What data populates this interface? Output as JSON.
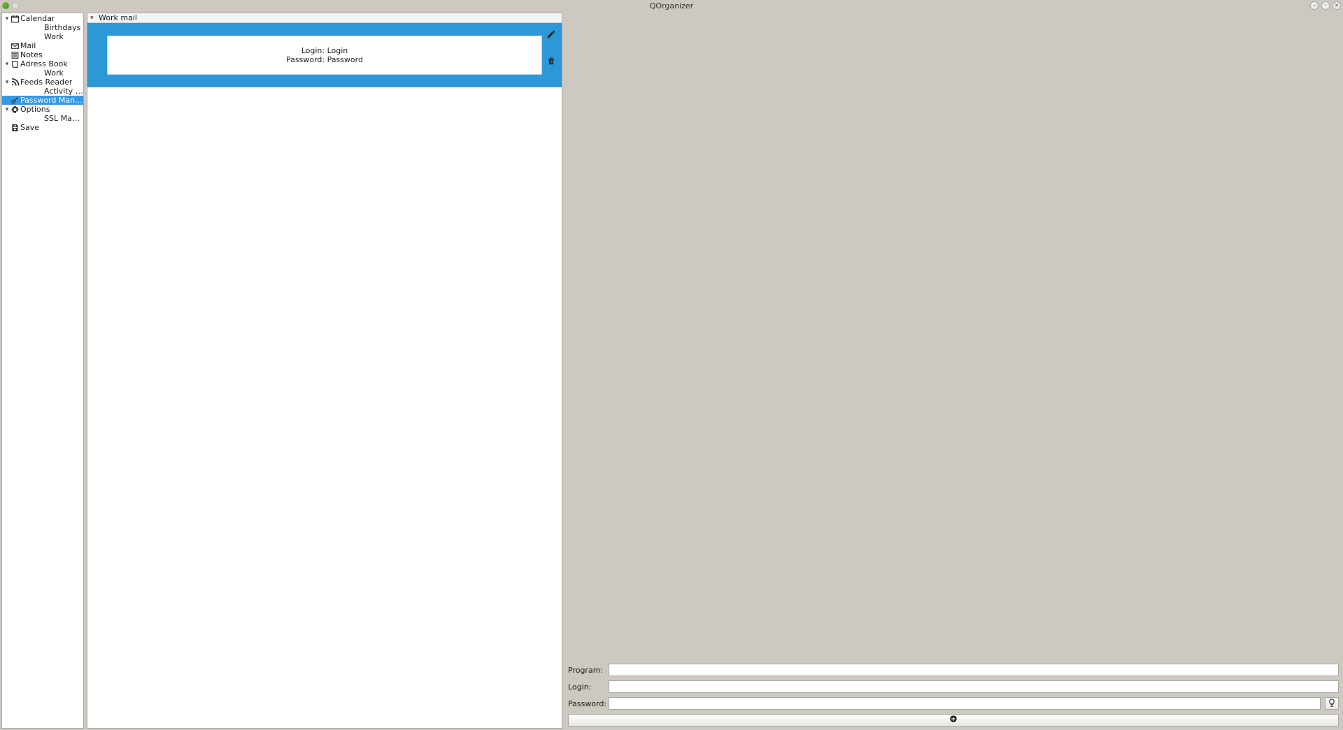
{
  "window": {
    "title": "QOrganizer"
  },
  "sidebar": {
    "items": [
      {
        "id": "calendar",
        "label": "Calendar",
        "icon": "calendar-icon",
        "expandable": true,
        "level": 0
      },
      {
        "id": "birthdays",
        "label": "Birthdays",
        "icon": "",
        "expandable": false,
        "level": 1
      },
      {
        "id": "work-cal",
        "label": "Work",
        "icon": "",
        "expandable": false,
        "level": 1
      },
      {
        "id": "mail",
        "label": "Mail",
        "icon": "mail-icon",
        "expandable": false,
        "level": 0
      },
      {
        "id": "notes",
        "label": "Notes",
        "icon": "notes-icon",
        "expandable": false,
        "level": 0
      },
      {
        "id": "addressbook",
        "label": "Adress Book",
        "icon": "book-icon",
        "expandable": true,
        "level": 0
      },
      {
        "id": "work-ab",
        "label": "Work",
        "icon": "",
        "expandable": false,
        "level": 1
      },
      {
        "id": "feeds",
        "label": "Feeds Reader",
        "icon": "rss-icon",
        "expandable": true,
        "level": 0
      },
      {
        "id": "activity",
        "label": "Activity for QO...",
        "icon": "",
        "expandable": false,
        "level": 1
      },
      {
        "id": "passwordman",
        "label": "Password Man...",
        "icon": "key-icon",
        "expandable": false,
        "level": 0,
        "selected": true
      },
      {
        "id": "options",
        "label": "Options",
        "icon": "gear-icon",
        "expandable": true,
        "level": 0
      },
      {
        "id": "sslmanager",
        "label": "SSL Manager",
        "icon": "",
        "expandable": false,
        "level": 1
      },
      {
        "id": "save",
        "label": "Save",
        "icon": "save-icon",
        "expandable": false,
        "level": 0
      }
    ]
  },
  "main": {
    "section_title": "Work mail",
    "entry": {
      "login_label": "Login:",
      "login_value": "Login",
      "password_label": "Password:",
      "password_value": "Password"
    }
  },
  "form": {
    "program_label": "Program:",
    "login_label": "Login:",
    "password_label": "Password:",
    "program_value": "",
    "login_value": "",
    "password_value": ""
  },
  "icons": {
    "expander_down": "▾",
    "add_glyph": "＋",
    "bulb_glyph": "💡"
  }
}
